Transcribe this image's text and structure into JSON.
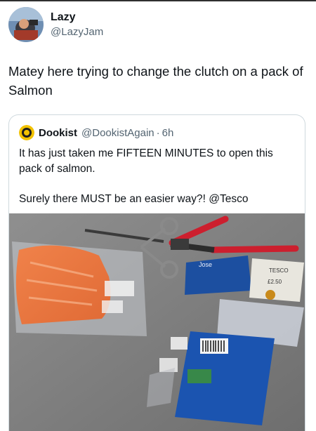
{
  "tweet": {
    "author_name": "Lazy",
    "author_handle": "@LazyJam",
    "text": "Matey here trying to change the clutch on a pack of Salmon"
  },
  "quoted_tweet": {
    "author_name": "Dookist",
    "author_handle": "@DookistAgain",
    "separator": "·",
    "time": "6h",
    "text_line1": "It has just taken me FIFTEEN MINUTES to open this pack of salmon.",
    "text_line2": "Surely there MUST be an easier way?! @Tesco"
  },
  "photo": {
    "label_top": "Jose",
    "tesco_label": "TESCO",
    "tag_price": "£2.50"
  }
}
